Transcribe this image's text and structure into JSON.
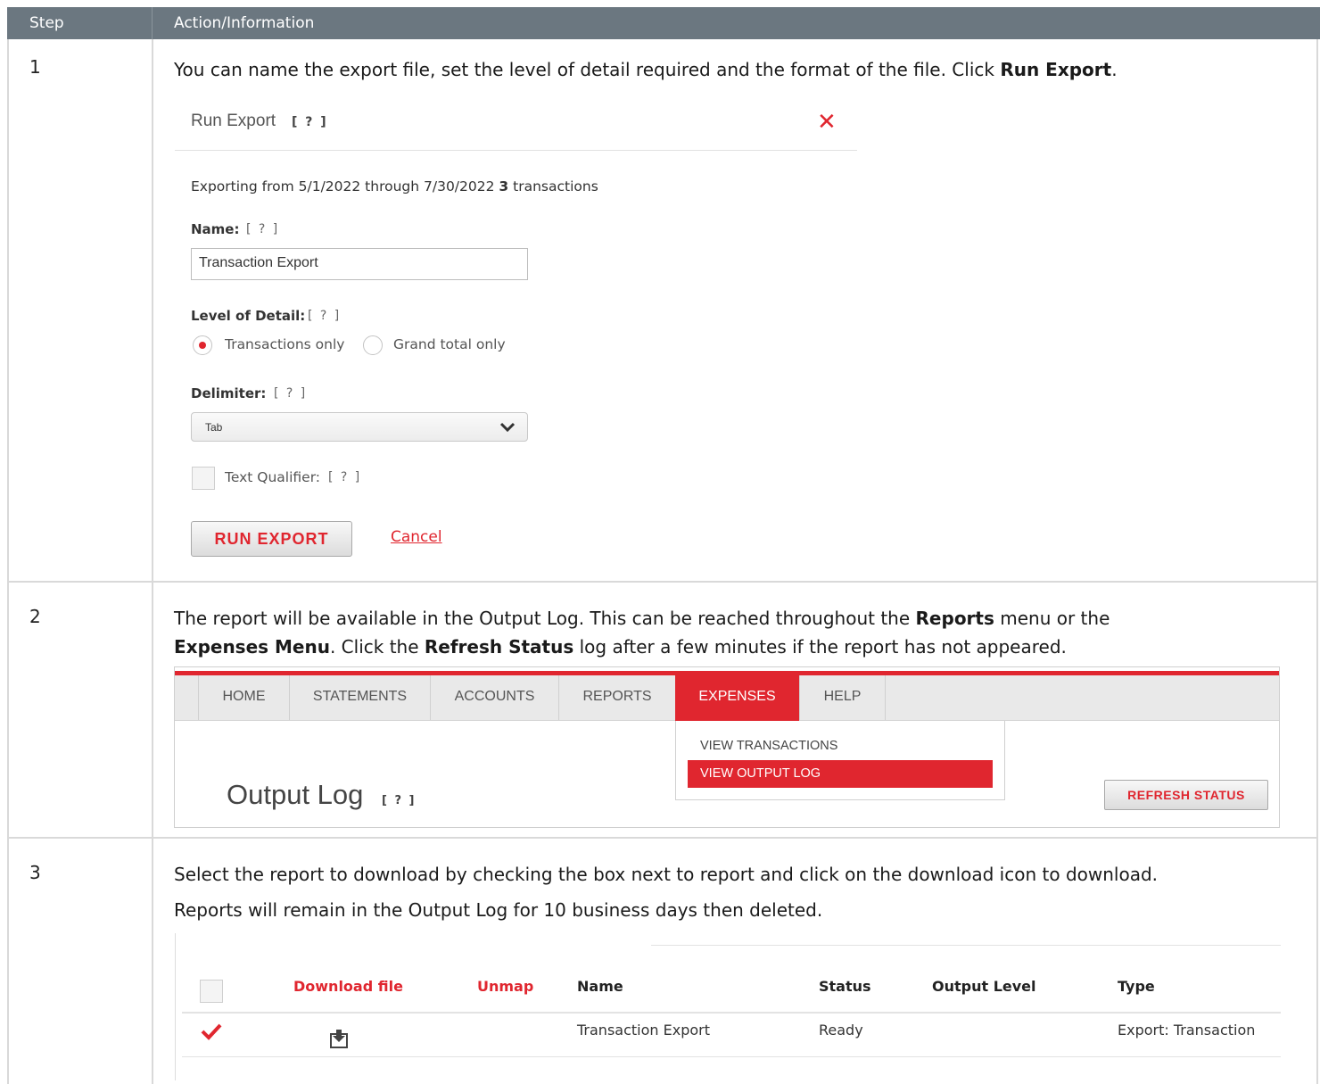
{
  "table": {
    "header": {
      "step": "Step",
      "action": "Action/Information"
    },
    "rows": [
      {
        "step": "1",
        "text_parts": [
          "You can name the export file, set the level of detail required and the format of the file. Click ",
          "Run Export",
          "."
        ],
        "dialog": {
          "title": "Run Export",
          "help": "[ ? ]",
          "close": "✕",
          "summary_prefix": "Exporting from 5/1/2022 through 7/30/2022 ",
          "summary_count": "3",
          "summary_suffix": " transactions",
          "name_label": "Name:",
          "name_help": "[ ? ]",
          "name_value": "Transaction Export",
          "detail_label": "Level of Detail:",
          "detail_help": "[ ? ]",
          "detail_options": [
            "Transactions only",
            "Grand total only"
          ],
          "detail_selected": "Transactions only",
          "delimiter_label": "Delimiter:",
          "delimiter_help": "[ ? ]",
          "delimiter_value": "Tab",
          "qualifier_label": "Text Qualifier:",
          "qualifier_help": "[ ? ]",
          "run_button": "RUN EXPORT",
          "cancel": "Cancel"
        }
      },
      {
        "step": "2",
        "line1_parts": [
          "The report will be available in the Output Log. This can be reached throughout the ",
          "Reports",
          " menu or the"
        ],
        "line2_parts": [
          "Expenses Menu",
          ". Click the ",
          "Refresh Status",
          " log after a few minutes if the report has not appeared."
        ],
        "nav": {
          "items": [
            "HOME",
            "STATEMENTS",
            "ACCOUNTS",
            "REPORTS",
            "EXPENSES",
            "HELP"
          ],
          "active": "EXPENSES",
          "dropdown": [
            "VIEW TRANSACTIONS",
            "VIEW OUTPUT LOG"
          ],
          "dropdown_active": "VIEW OUTPUT LOG",
          "page_title": "Output Log",
          "page_help": "[ ? ]",
          "refresh_button": "REFRESH STATUS"
        }
      },
      {
        "step": "3",
        "line1": "Select the report to download by checking the box next to report and click on the download icon to download.",
        "line2": "Reports will remain in the Output Log for 10 business days then deleted.",
        "output_table": {
          "columns": [
            "Download file",
            "Unmap",
            "Name",
            "Status",
            "Output Level",
            "Type"
          ],
          "rows": [
            {
              "checked": true,
              "name": "Transaction Export",
              "status": "Ready",
              "output_level": "",
              "type": "Export: Transaction"
            }
          ]
        }
      }
    ]
  },
  "colors": {
    "header_bg": "#6b7780",
    "accent": "#e0262f",
    "border": "#d9d9d9"
  }
}
